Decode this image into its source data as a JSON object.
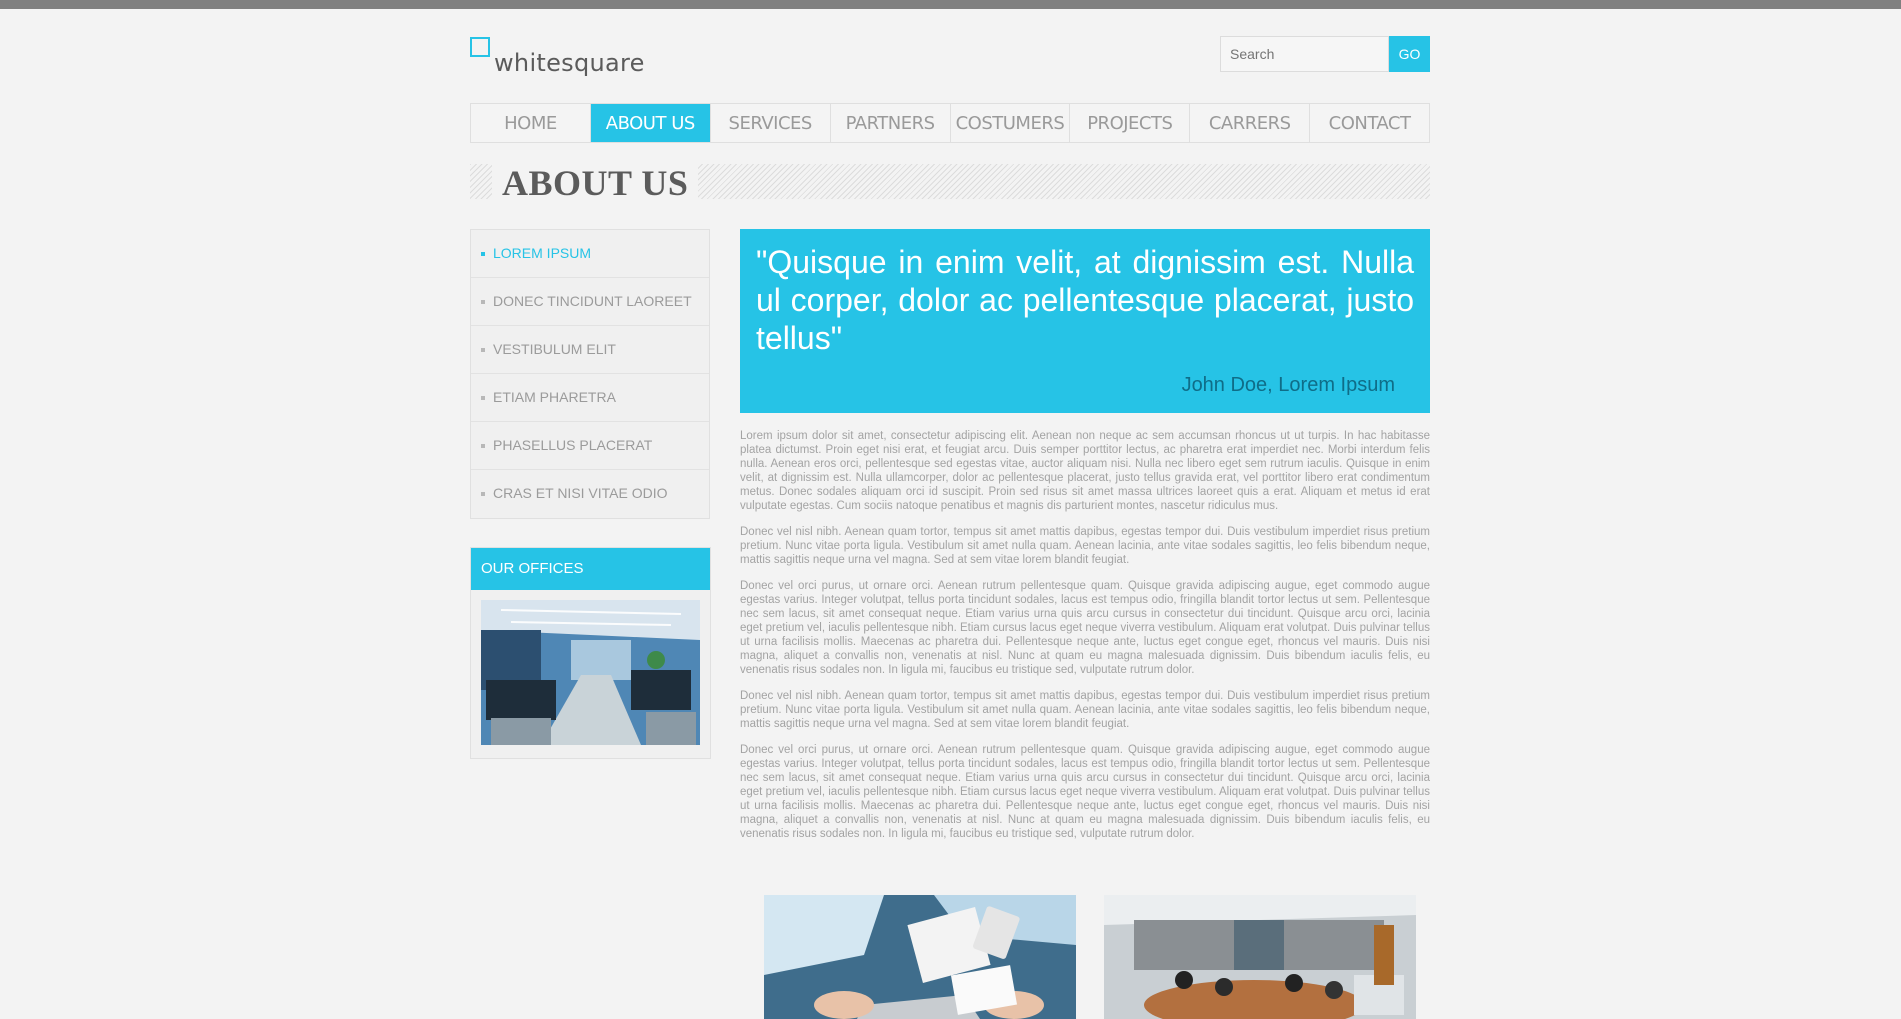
{
  "brand": {
    "name": "whitesquare",
    "accent": "#26c3e6"
  },
  "search": {
    "placeholder": "Search",
    "button": "GO"
  },
  "nav": {
    "items": [
      "HOME",
      "ABOUT US",
      "SERVICES",
      "PARTNERS",
      "COSTUMERS",
      "PROJECTS",
      "CARRERS",
      "CONTACT"
    ],
    "active": "ABOUT US"
  },
  "page": {
    "title": "ABOUT US"
  },
  "sidebar": {
    "items": [
      "LOREM IPSUM",
      "DONEC TINCIDUNT LAOREET",
      "VESTIBULUM ELIT",
      "ETIAM PHARETRA",
      "PHASELLUS PLACERAT",
      "CRAS ET NISI VITAE ODIO"
    ],
    "active": "LOREM IPSUM",
    "offices_title": "OUR OFFICES"
  },
  "quote": {
    "text": "\"Quisque in enim velit, at dignissim est. Nulla ul corper, dolor ac pellentesque placerat, justo tellus\"",
    "author": "John Doe, Lorem Ipsum"
  },
  "paragraphs": [
    "Lorem ipsum dolor sit amet, consectetur adipiscing elit. Aenean non neque ac sem accumsan rhoncus ut ut turpis. In hac habitasse platea dictumst. Proin eget nisi erat, et feugiat arcu. Duis semper porttitor lectus, ac pharetra erat imperdiet nec. Morbi interdum felis nulla. Aenean eros orci, pellentesque sed egestas vitae, auctor aliquam nisi. Nulla nec libero eget sem rutrum iaculis. Quisque in enim velit, at dignissim est. Nulla ullamcorper, dolor ac pellentesque placerat, justo tellus gravida erat, vel porttitor libero erat condimentum metus. Donec sodales aliquam orci id suscipit. Proin sed risus sit amet massa ultrices laoreet quis a erat. Aliquam et metus id erat vulputate egestas. Cum sociis natoque penatibus et magnis dis parturient montes, nascetur ridiculus mus.",
    "Donec vel nisl nibh. Aenean quam tortor, tempus sit amet mattis dapibus, egestas tempor dui. Duis vestibulum imperdiet risus pretium pretium. Nunc vitae porta ligula. Vestibulum sit amet nulla quam. Aenean lacinia, ante vitae sodales sagittis, leo felis bibendum neque, mattis sagittis neque urna vel magna. Sed at sem vitae lorem blandit feugiat.",
    "Donec vel orci purus, ut ornare orci. Aenean rutrum pellentesque quam. Quisque gravida adipiscing augue, eget commodo augue egestas varius. Integer volutpat, tellus porta tincidunt sodales, lacus est tempus odio, fringilla blandit tortor lectus ut sem. Pellentesque nec sem lacus, sit amet consequat neque. Etiam varius urna quis arcu cursus in consectetur dui tincidunt. Quisque arcu orci, lacinia eget pretium vel, iaculis pellentesque nibh. Etiam cursus lacus eget neque viverra vestibulum. Aliquam erat volutpat. Duis pulvinar tellus ut urna facilisis mollis. Maecenas ac pharetra dui. Pellentesque neque ante, luctus eget congue eget, rhoncus vel mauris. Duis nisi magna, aliquet a convallis non, venenatis at nisl. Nunc at quam eu magna malesuada dignissim. Duis bibendum iaculis felis, eu venenatis risus sodales non. In ligula mi, faucibus eu tristique sed, vulputate rutrum dolor.",
    "Donec vel nisl nibh. Aenean quam tortor, tempus sit amet mattis dapibus, egestas tempor dui. Duis vestibulum imperdiet risus pretium pretium. Nunc vitae porta ligula. Vestibulum sit amet nulla quam. Aenean lacinia, ante vitae sodales sagittis, leo felis bibendum neque, mattis sagittis neque urna vel magna. Sed at sem vitae lorem blandit feugiat.",
    "Donec vel orci purus, ut ornare orci. Aenean rutrum pellentesque quam. Quisque gravida adipiscing augue, eget commodo augue egestas varius. Integer volutpat, tellus porta tincidunt sodales, lacus est tempus odio, fringilla blandit tortor lectus ut sem. Pellentesque nec sem lacus, sit amet consequat neque. Etiam varius urna quis arcu cursus in consectetur dui tincidunt. Quisque arcu orci, lacinia eget pretium vel, iaculis pellentesque nibh. Etiam cursus lacus eget neque viverra vestibulum. Aliquam erat volutpat. Duis pulvinar tellus ut urna facilisis mollis. Maecenas ac pharetra dui. Pellentesque neque ante, luctus eget congue eget, rhoncus vel mauris. Duis nisi magna, aliquet a convallis non, venenatis at nisl. Nunc at quam eu magna malesuada dignissim. Duis bibendum iaculis felis, eu venenatis risus sodales non. In ligula mi, faucibus eu tristique sed, vulputate rutrum dolor."
  ]
}
